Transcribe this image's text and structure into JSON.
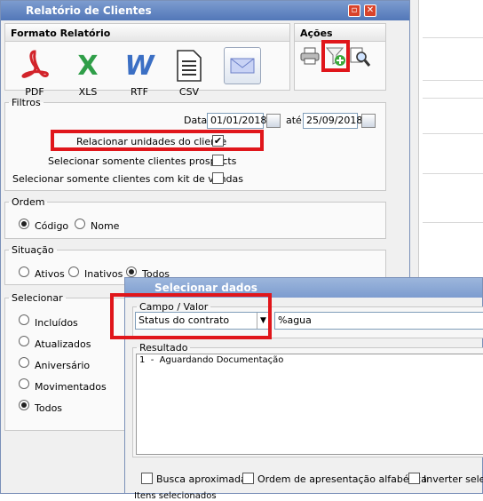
{
  "window": {
    "title": "Relatório de Clientes"
  },
  "formato": {
    "header": "Formato Relatório",
    "items": [
      {
        "label": "PDF",
        "icon": "pdf-icon"
      },
      {
        "label": "XLS",
        "icon": "excel-icon"
      },
      {
        "label": "RTF",
        "icon": "word-icon"
      },
      {
        "label": "CSV",
        "icon": "csv-document-icon"
      },
      {
        "label": "",
        "icon": "email-envelope-icon"
      }
    ]
  },
  "acoes": {
    "header": "Ações",
    "icons": [
      "printer-icon",
      "filter-add-icon",
      "search-preview-icon"
    ]
  },
  "filtros": {
    "legend": "Filtros",
    "date_label": "Data:",
    "date_from": "01/01/2018",
    "until_label": "até:",
    "date_to": "25/09/2018",
    "relacionar_label": "Relacionar unidades do cliente",
    "relacionar_checked": true,
    "prospects_label": "Selecionar somente clientes prospects",
    "kit_label": "Selecionar somente clientes com kit de vendas"
  },
  "ordem": {
    "legend": "Ordem",
    "options": [
      "Código",
      "Nome"
    ],
    "selected": "Código"
  },
  "situacao": {
    "legend": "Situação",
    "options": [
      "Ativos",
      "Inativos",
      "Todos"
    ],
    "selected": "Todos"
  },
  "selecionar": {
    "legend": "Selecionar",
    "options": [
      "Incluídos",
      "Atualizados",
      "Aniversário",
      "Movimentados",
      "Todos"
    ],
    "selected": "Todos"
  },
  "dialog": {
    "title": "Selecionar dados",
    "campo_legend": "Campo / Valor",
    "campo_value": "Status do contrato",
    "valor_value": "%agua",
    "resultado_legend": "Resultado",
    "resultado_items": [
      "1  -  Aguardando Documentação"
    ],
    "busca_label": "Busca aproximada",
    "ordem_label": "Ordem de apresentação alfabética",
    "inverter_label": "Inverter seleção",
    "bottom_partial": "Itens selecionados"
  },
  "colors": {
    "highlight": "#e0161b",
    "title_bar": "#5277b8"
  }
}
